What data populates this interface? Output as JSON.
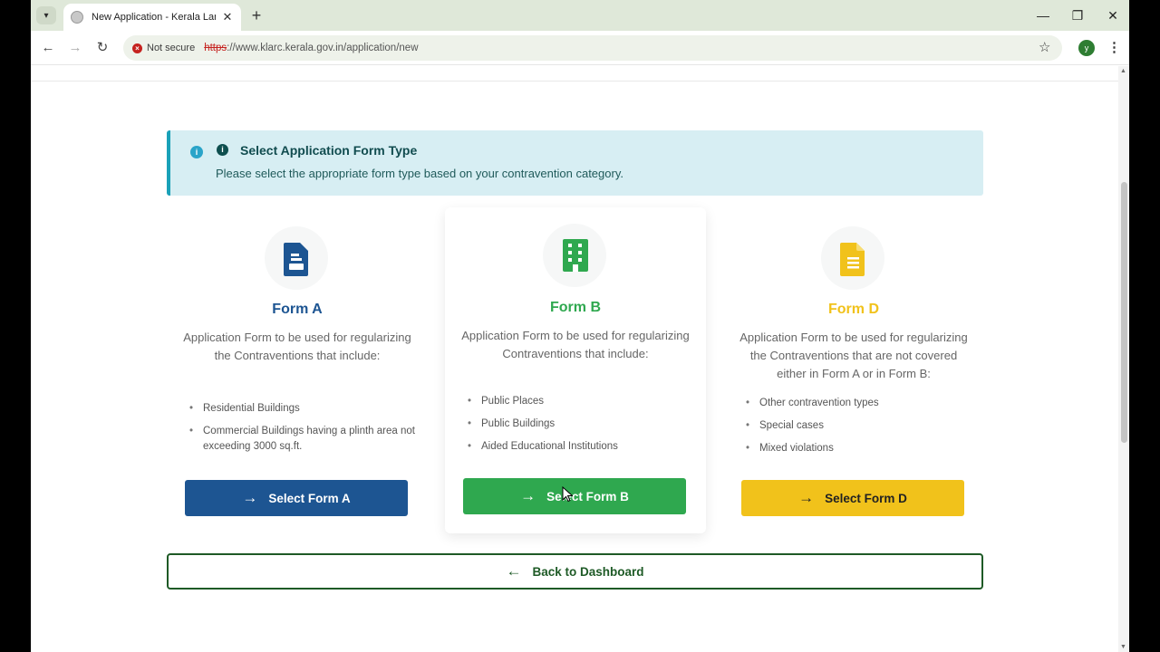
{
  "browser": {
    "tab_title": "New Application - Kerala Land",
    "tab_close": "✕",
    "new_tab": "+",
    "security_label": "Not secure",
    "url_scheme": "https",
    "url_rest": "://www.klarc.kerala.gov.in/application/new",
    "profile_initial": "y"
  },
  "alert": {
    "title": "Select Application Form Type",
    "text": "Please select the appropriate form type based on your contravention category."
  },
  "forms": [
    {
      "title": "Form A",
      "color": "#1d5592",
      "icon": "document-icon",
      "desc": "Application Form to be used for regular­izing the Contraventions that include:",
      "items": [
        "Residential Buildings",
        "Commercial Buildings having a plinth area not exceeding 3000 sq.ft."
      ],
      "button": "Select Form A"
    },
    {
      "title": "Form B",
      "color": "#2fa84f",
      "icon": "building-icon",
      "desc": "Application Form to be used for regular­izing Contraventions that include:",
      "items": [
        "Public Places",
        "Public Buildings",
        "Aided Educational Institutions"
      ],
      "button": "Select Form B"
    },
    {
      "title": "Form D",
      "color": "#f1c21b",
      "icon": "file-lines-icon",
      "desc": "Application Form to be used for regular­izing the Contraventions that are not covered either in Form A or in Form B:",
      "items": [
        "Other contravention types",
        "Special cases",
        "Mixed violations"
      ],
      "button": "Select Form D"
    }
  ],
  "back_button": "Back to Dashboard"
}
